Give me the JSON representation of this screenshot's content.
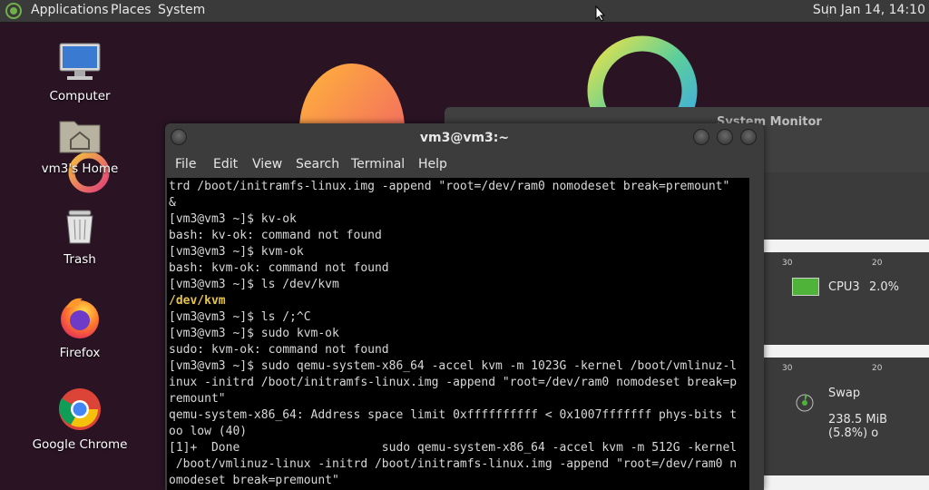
{
  "panel": {
    "menus": [
      "Applications",
      "Places",
      "System"
    ],
    "clock": "Sun Jan 14, 14:10"
  },
  "desktop_icons": [
    {
      "label": "Computer",
      "icon": "computer-icon"
    },
    {
      "label": "vm3's Home",
      "icon": "home-folder-icon"
    },
    {
      "label": "Trash",
      "icon": "trash-icon"
    },
    {
      "label": "Firefox",
      "icon": "firefox-icon"
    },
    {
      "label": "Google Chrome",
      "icon": "chrome-icon"
    }
  ],
  "system_monitor": {
    "title": "System Monitor",
    "ticks": [
      "30",
      "20"
    ],
    "cpu_label": "CPU3",
    "cpu_value": "2.0%",
    "cpu_color": "#4fb33a",
    "swap_label": "Swap",
    "swap_value": "238.5 MiB (5.8%) o"
  },
  "terminal": {
    "title": "vm3@vm3:~",
    "menus": [
      "File",
      "Edit",
      "View",
      "Search",
      "Terminal",
      "Help"
    ],
    "lines": [
      "trd /boot/initramfs-linux.img -append \"root=/dev/ram0 nomodeset break=premount\"",
      "&",
      "[vm3@vm3 ~]$ kv-ok",
      "bash: kv-ok: command not found",
      "[vm3@vm3 ~]$ kvm-ok",
      "bash: kvm-ok: command not found",
      "[vm3@vm3 ~]$ ls /dev/kvm",
      "/dev/kvm",
      "[vm3@vm3 ~]$ ls /;^C",
      "[vm3@vm3 ~]$ sudo kvm-ok",
      "sudo: kvm-ok: command not found",
      "[vm3@vm3 ~]$ sudo qemu-system-x86_64 -accel kvm -m 1023G -kernel /boot/vmlinuz-l",
      "inux -initrd /boot/initramfs-linux.img -append \"root=/dev/ram0 nomodeset break=p",
      "remount\"",
      "qemu-system-x86_64: Address space limit 0xffffffffff < 0x1007fffffff phys-bits t",
      "oo low (40)",
      "[1]+  Done                    sudo qemu-system-x86_64 -accel kvm -m 512G -kernel",
      " /boot/vmlinuz-linux -initrd /boot/initramfs-linux.img -append \"root=/dev/ram0 n",
      "omodeset break=premount\""
    ]
  }
}
